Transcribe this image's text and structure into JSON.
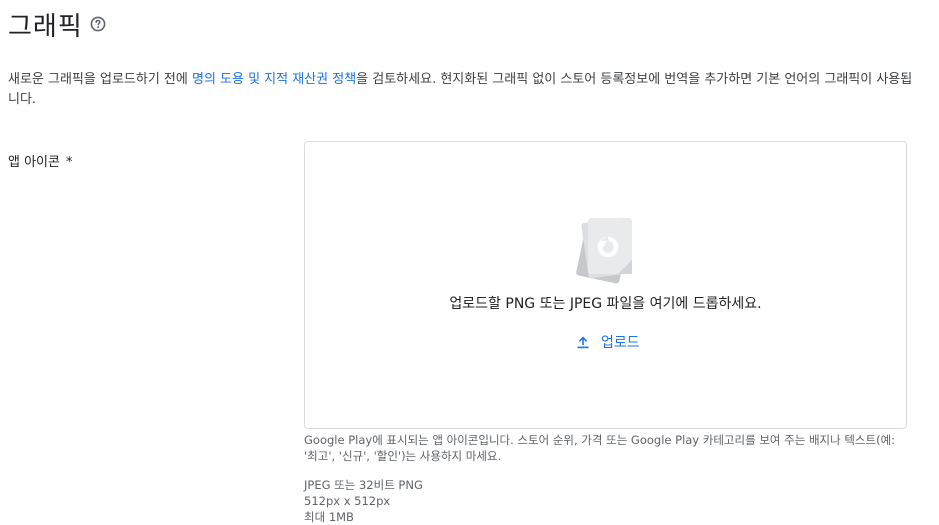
{
  "header": {
    "title": "그래픽",
    "help_icon": "help-circle-icon"
  },
  "intro": {
    "text_before_link": "새로운 그래픽을 업로드하기 전에 ",
    "link_text": "명의 도용 및 지적 재산권 정책",
    "text_after_link": "을 검토하세요. 현지화된 그래픽 없이 스토어 등록정보에 번역을 추가하면 기본 언어의 그래픽이 사용됩니다."
  },
  "app_icon_field": {
    "label": "앱 아이콘",
    "required_mark": "*",
    "dropzone": {
      "illustration_icon": "image-file-stack-icon",
      "instruction": "업로드할 PNG 또는 JPEG 파일을 여기에 드롭하세요.",
      "upload_label": "업로드",
      "upload_icon": "upload-icon"
    },
    "help_text": "Google Play에 표시되는 앱 아이콘입니다. 스토어 순위, 가격 또는 Google Play 카테고리를 보여 주는 배지나 텍스트(예: '최고', '신규', '할인')는 사용하지 마세요.",
    "specs": [
      "JPEG 또는 32비트 PNG",
      "512px x 512px",
      "최대 1MB"
    ]
  },
  "colors": {
    "link": "#1a73e8",
    "border": "#dadce0",
    "text_primary": "#202124",
    "text_secondary": "#5f6368"
  }
}
